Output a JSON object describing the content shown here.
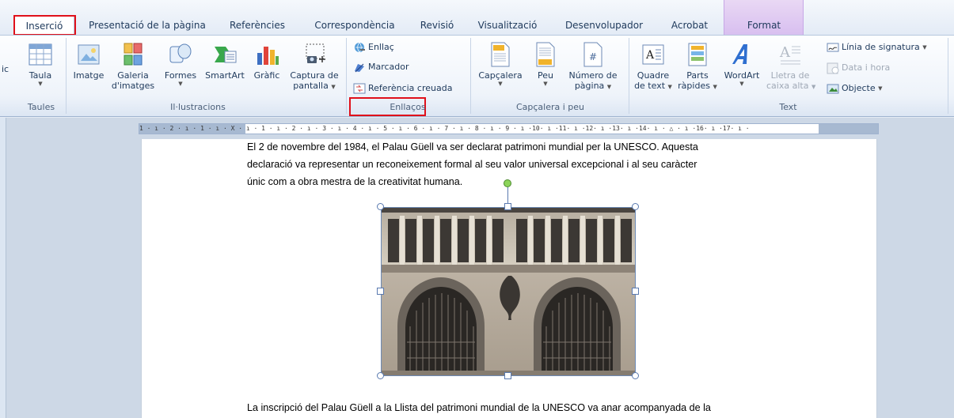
{
  "tabs": [
    {
      "label": "Inserció",
      "active": true
    },
    {
      "label": "Presentació de la pàgina"
    },
    {
      "label": "Referències"
    },
    {
      "label": "Correspondència"
    },
    {
      "label": "Revisió"
    },
    {
      "label": "Visualització"
    },
    {
      "label": "Desenvolupador"
    },
    {
      "label": "Acrobat"
    },
    {
      "label": "Format"
    }
  ],
  "ribbon": {
    "leftcut": "ic",
    "taules": {
      "button": "Taula",
      "group": "Taules"
    },
    "illustracions": {
      "group": "Il·lustracions",
      "imatge": "Imatge",
      "galeria1": "Galeria",
      "galeria2": "d'imatges",
      "formes": "Formes",
      "smartart": "SmartArt",
      "grafic": "Gràfic",
      "captura1": "Captura de",
      "captura2": "pantalla"
    },
    "enllacos": {
      "group": "Enllaços",
      "enllac": "Enllaç",
      "marcador": "Marcador",
      "referencia": "Referència creuada"
    },
    "capcalera": {
      "group": "Capçalera i peu",
      "capcalera": "Capçalera",
      "peu": "Peu",
      "numero1": "Número de",
      "numero2": "pàgina"
    },
    "text": {
      "group": "Text",
      "quadre1": "Quadre",
      "quadre2": "de text",
      "parts1": "Parts",
      "parts2": "ràpides",
      "wordart": "WordArt",
      "lletra1": "Lletra de",
      "lletra2": "caixa alta",
      "linia": "Línia de signatura",
      "data": "Data i hora",
      "objecte": "Objecte"
    }
  },
  "ruler": {
    "text": "1 · ı · 2 · ı · 1 · ı · X · ı · 1 · ı · 2 · ı · 3 · ı · 4 · ı · 5 · ı · 6 · ı · 7 · ı · 8 · ı · 9 · ı ·10· ı ·11· ı ·12· ı ·13· ı ·14· ı · △ · ı ·16· ı ·17· ı ·"
  },
  "document": {
    "para1_line1": "El 2 de novembre del 1984, el Palau Güell va ser declarat patrimoni mundial per la UNESCO. Aquesta",
    "para1_line2": "declaració va representar un reconeixement formal al seu valor universal excepcional i al seu caràcter",
    "para1_line3": "únic com a obra mestra de la creativitat humana.",
    "para2_line1": "La inscripció del Palau Güell a la Llista del patrimoni mundial de la UNESCO va anar acompanyada de la"
  },
  "colors": {
    "highlight": "#e0101a",
    "selection_handle": "#5a7ab0",
    "rotate_handle": "#8cd45a"
  }
}
